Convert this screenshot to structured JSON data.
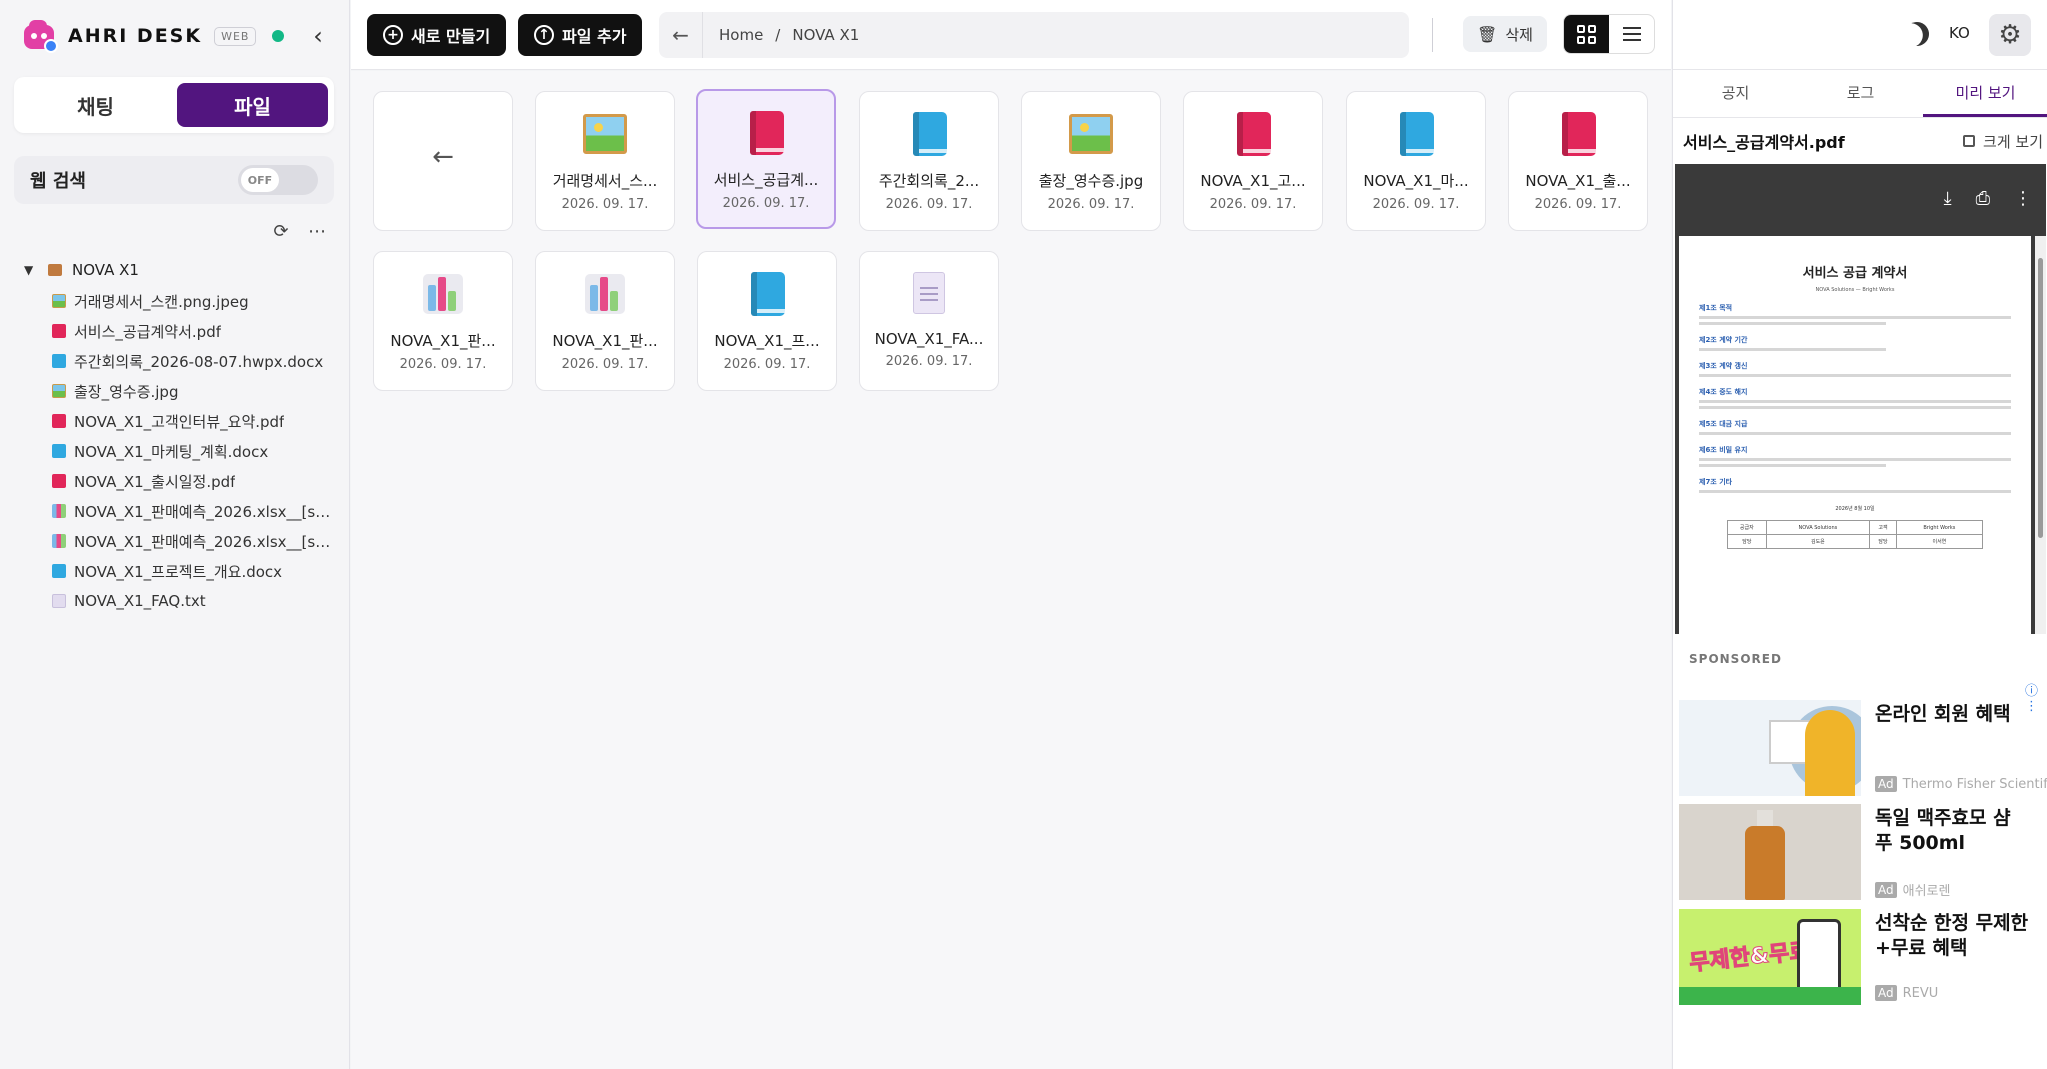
{
  "app": {
    "brand_name": "AHRI DESK",
    "web_tag": "WEB",
    "status_color": "#12b886",
    "accent_color": "#52157f"
  },
  "sidebar": {
    "mode_tabs": [
      {
        "label": "채팅",
        "active": false
      },
      {
        "label": "파일",
        "active": true
      }
    ],
    "web_search": {
      "label": "웹 검색",
      "toggle_state": "OFF"
    },
    "tree": {
      "root": "NOVA X1",
      "items": [
        {
          "name": "거래명세서_스캔.png.jpeg",
          "type": "img"
        },
        {
          "name": "서비스_공급계약서.pdf",
          "type": "pdf"
        },
        {
          "name": "주간회의록_2026-08-07.hwpx.docx",
          "type": "doc"
        },
        {
          "name": "출장_영수증.jpg",
          "type": "img"
        },
        {
          "name": "NOVA_X1_고객인터뷰_요약.pdf",
          "type": "pdf"
        },
        {
          "name": "NOVA_X1_마케팅_계획.docx",
          "type": "doc"
        },
        {
          "name": "NOVA_X1_출시일정.pdf",
          "type": "pdf"
        },
        {
          "name": "NOVA_X1_판매예측_2026.xlsx__[sh...",
          "type": "xls"
        },
        {
          "name": "NOVA_X1_판매예측_2026.xlsx__[sh...",
          "type": "xls"
        },
        {
          "name": "NOVA_X1_프로젝트_개요.docx",
          "type": "doc"
        },
        {
          "name": "NOVA_X1_FAQ.txt",
          "type": "txt"
        }
      ]
    }
  },
  "toolbar": {
    "new_label": "새로 만들기",
    "add_file_label": "파일 추가",
    "breadcrumb": [
      "Home",
      "/",
      "NOVA X1"
    ],
    "delete_label": "삭제"
  },
  "files": [
    {
      "name": "거래명세서_스...",
      "date": "2026. 09. 17.",
      "type": "img"
    },
    {
      "name": "서비스_공급계...",
      "date": "2026. 09. 17.",
      "type": "pdf",
      "selected": true
    },
    {
      "name": "주간회의록_2...",
      "date": "2026. 09. 17.",
      "type": "doc"
    },
    {
      "name": "출장_영수증.jpg",
      "date": "2026. 09. 17.",
      "type": "img"
    },
    {
      "name": "NOVA_X1_고...",
      "date": "2026. 09. 17.",
      "type": "pdf"
    },
    {
      "name": "NOVA_X1_마...",
      "date": "2026. 09. 17.",
      "type": "doc"
    },
    {
      "name": "NOVA_X1_출...",
      "date": "2026. 09. 17.",
      "type": "pdf"
    },
    {
      "name": "NOVA_X1_판...",
      "date": "2026. 09. 17.",
      "type": "xls"
    },
    {
      "name": "NOVA_X1_판...",
      "date": "2026. 09. 17.",
      "type": "xls"
    },
    {
      "name": "NOVA_X1_프...",
      "date": "2026. 09. 17.",
      "type": "doc"
    },
    {
      "name": "NOVA_X1_FA...",
      "date": "2026. 09. 17.",
      "type": "txt"
    }
  ],
  "right_panel": {
    "lang": "KO",
    "tabs": [
      {
        "label": "공지",
        "active": false
      },
      {
        "label": "로그",
        "active": false
      },
      {
        "label": "미리 보기",
        "active": true
      }
    ],
    "preview_filename": "서비스_공급계약서.pdf",
    "expand_label": "크게 보기",
    "doc": {
      "title": "서비스 공급 계약서",
      "subtitle": "NOVA Solutions — Bright Works",
      "sections": [
        "제1조 목적",
        "제2조 계약 기간",
        "제3조 계약 갱신",
        "제4조 중도 해지",
        "제5조 대금 지급",
        "제6조 비밀 유지",
        "제7조 기타"
      ],
      "date": "2026년 8월 10일",
      "table": [
        [
          "공급자",
          "NOVA Solutions",
          "고객",
          "Bright Works"
        ],
        [
          "담당",
          "김도윤",
          "담당",
          "이서연"
        ]
      ]
    },
    "sponsored_label": "SPONSORED",
    "ads": [
      {
        "title": "온라인 회원 혜택",
        "source": "Thermo Fisher Scientific",
        "ad_tag": "Ad"
      },
      {
        "title": "독일 맥주효모 샴푸 500ml",
        "source": "애쉬로렌",
        "ad_tag": "Ad"
      },
      {
        "title": "선착순 한정 무제한+무료 혜택",
        "source": "REVU",
        "ad_tag": "Ad"
      }
    ],
    "ad3_banner_text": "무제한&무료"
  }
}
